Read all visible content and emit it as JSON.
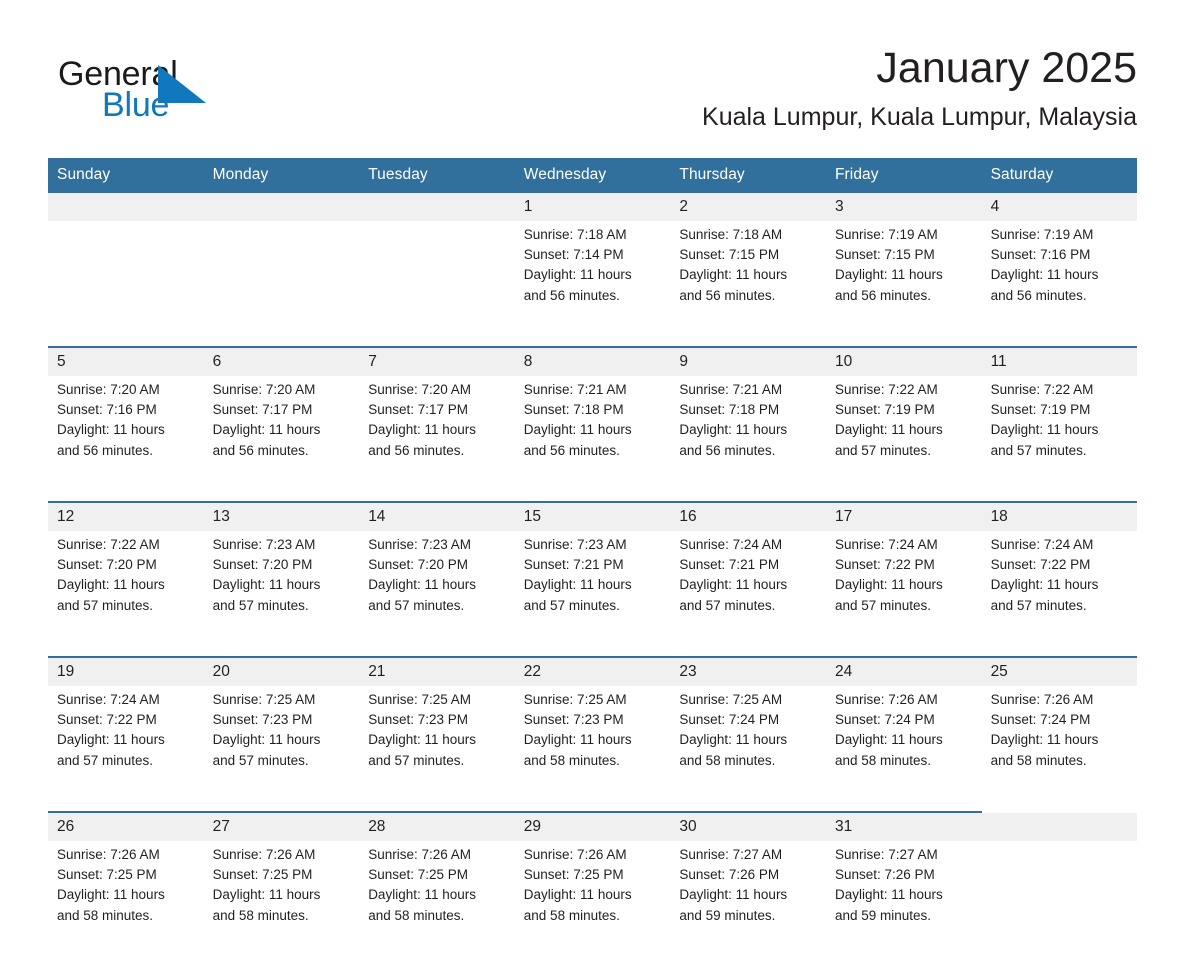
{
  "logo": {
    "word_one": "General",
    "word_two": "Blue",
    "triangle_color": "#1278be",
    "text_color": "#1a1a1a"
  },
  "header": {
    "title": "January 2025",
    "subtitle": "Kuala Lumpur, Kuala Lumpur, Malaysia"
  },
  "theme": {
    "header_blue": "#31709c",
    "daynum_band": "#f0f0f0",
    "text": "#231f20"
  },
  "weekdays": [
    "Sunday",
    "Monday",
    "Tuesday",
    "Wednesday",
    "Thursday",
    "Friday",
    "Saturday"
  ],
  "weeks": [
    [
      {
        "day": "",
        "lines": []
      },
      {
        "day": "",
        "lines": []
      },
      {
        "day": "",
        "lines": []
      },
      {
        "day": "1",
        "lines": [
          "Sunrise: 7:18 AM",
          "Sunset: 7:14 PM",
          "Daylight: 11 hours",
          "and 56 minutes."
        ]
      },
      {
        "day": "2",
        "lines": [
          "Sunrise: 7:18 AM",
          "Sunset: 7:15 PM",
          "Daylight: 11 hours",
          "and 56 minutes."
        ]
      },
      {
        "day": "3",
        "lines": [
          "Sunrise: 7:19 AM",
          "Sunset: 7:15 PM",
          "Daylight: 11 hours",
          "and 56 minutes."
        ]
      },
      {
        "day": "4",
        "lines": [
          "Sunrise: 7:19 AM",
          "Sunset: 7:16 PM",
          "Daylight: 11 hours",
          "and 56 minutes."
        ]
      }
    ],
    [
      {
        "day": "5",
        "lines": [
          "Sunrise: 7:20 AM",
          "Sunset: 7:16 PM",
          "Daylight: 11 hours",
          "and 56 minutes."
        ]
      },
      {
        "day": "6",
        "lines": [
          "Sunrise: 7:20 AM",
          "Sunset: 7:17 PM",
          "Daylight: 11 hours",
          "and 56 minutes."
        ]
      },
      {
        "day": "7",
        "lines": [
          "Sunrise: 7:20 AM",
          "Sunset: 7:17 PM",
          "Daylight: 11 hours",
          "and 56 minutes."
        ]
      },
      {
        "day": "8",
        "lines": [
          "Sunrise: 7:21 AM",
          "Sunset: 7:18 PM",
          "Daylight: 11 hours",
          "and 56 minutes."
        ]
      },
      {
        "day": "9",
        "lines": [
          "Sunrise: 7:21 AM",
          "Sunset: 7:18 PM",
          "Daylight: 11 hours",
          "and 56 minutes."
        ]
      },
      {
        "day": "10",
        "lines": [
          "Sunrise: 7:22 AM",
          "Sunset: 7:19 PM",
          "Daylight: 11 hours",
          "and 57 minutes."
        ]
      },
      {
        "day": "11",
        "lines": [
          "Sunrise: 7:22 AM",
          "Sunset: 7:19 PM",
          "Daylight: 11 hours",
          "and 57 minutes."
        ]
      }
    ],
    [
      {
        "day": "12",
        "lines": [
          "Sunrise: 7:22 AM",
          "Sunset: 7:20 PM",
          "Daylight: 11 hours",
          "and 57 minutes."
        ]
      },
      {
        "day": "13",
        "lines": [
          "Sunrise: 7:23 AM",
          "Sunset: 7:20 PM",
          "Daylight: 11 hours",
          "and 57 minutes."
        ]
      },
      {
        "day": "14",
        "lines": [
          "Sunrise: 7:23 AM",
          "Sunset: 7:20 PM",
          "Daylight: 11 hours",
          "and 57 minutes."
        ]
      },
      {
        "day": "15",
        "lines": [
          "Sunrise: 7:23 AM",
          "Sunset: 7:21 PM",
          "Daylight: 11 hours",
          "and 57 minutes."
        ]
      },
      {
        "day": "16",
        "lines": [
          "Sunrise: 7:24 AM",
          "Sunset: 7:21 PM",
          "Daylight: 11 hours",
          "and 57 minutes."
        ]
      },
      {
        "day": "17",
        "lines": [
          "Sunrise: 7:24 AM",
          "Sunset: 7:22 PM",
          "Daylight: 11 hours",
          "and 57 minutes."
        ]
      },
      {
        "day": "18",
        "lines": [
          "Sunrise: 7:24 AM",
          "Sunset: 7:22 PM",
          "Daylight: 11 hours",
          "and 57 minutes."
        ]
      }
    ],
    [
      {
        "day": "19",
        "lines": [
          "Sunrise: 7:24 AM",
          "Sunset: 7:22 PM",
          "Daylight: 11 hours",
          "and 57 minutes."
        ]
      },
      {
        "day": "20",
        "lines": [
          "Sunrise: 7:25 AM",
          "Sunset: 7:23 PM",
          "Daylight: 11 hours",
          "and 57 minutes."
        ]
      },
      {
        "day": "21",
        "lines": [
          "Sunrise: 7:25 AM",
          "Sunset: 7:23 PM",
          "Daylight: 11 hours",
          "and 57 minutes."
        ]
      },
      {
        "day": "22",
        "lines": [
          "Sunrise: 7:25 AM",
          "Sunset: 7:23 PM",
          "Daylight: 11 hours",
          "and 58 minutes."
        ]
      },
      {
        "day": "23",
        "lines": [
          "Sunrise: 7:25 AM",
          "Sunset: 7:24 PM",
          "Daylight: 11 hours",
          "and 58 minutes."
        ]
      },
      {
        "day": "24",
        "lines": [
          "Sunrise: 7:26 AM",
          "Sunset: 7:24 PM",
          "Daylight: 11 hours",
          "and 58 minutes."
        ]
      },
      {
        "day": "25",
        "lines": [
          "Sunrise: 7:26 AM",
          "Sunset: 7:24 PM",
          "Daylight: 11 hours",
          "and 58 minutes."
        ]
      }
    ],
    [
      {
        "day": "26",
        "lines": [
          "Sunrise: 7:26 AM",
          "Sunset: 7:25 PM",
          "Daylight: 11 hours",
          "and 58 minutes."
        ]
      },
      {
        "day": "27",
        "lines": [
          "Sunrise: 7:26 AM",
          "Sunset: 7:25 PM",
          "Daylight: 11 hours",
          "and 58 minutes."
        ]
      },
      {
        "day": "28",
        "lines": [
          "Sunrise: 7:26 AM",
          "Sunset: 7:25 PM",
          "Daylight: 11 hours",
          "and 58 minutes."
        ]
      },
      {
        "day": "29",
        "lines": [
          "Sunrise: 7:26 AM",
          "Sunset: 7:25 PM",
          "Daylight: 11 hours",
          "and 58 minutes."
        ]
      },
      {
        "day": "30",
        "lines": [
          "Sunrise: 7:27 AM",
          "Sunset: 7:26 PM",
          "Daylight: 11 hours",
          "and 59 minutes."
        ]
      },
      {
        "day": "31",
        "lines": [
          "Sunrise: 7:27 AM",
          "Sunset: 7:26 PM",
          "Daylight: 11 hours",
          "and 59 minutes."
        ]
      },
      {
        "day": "",
        "lines": []
      }
    ]
  ]
}
